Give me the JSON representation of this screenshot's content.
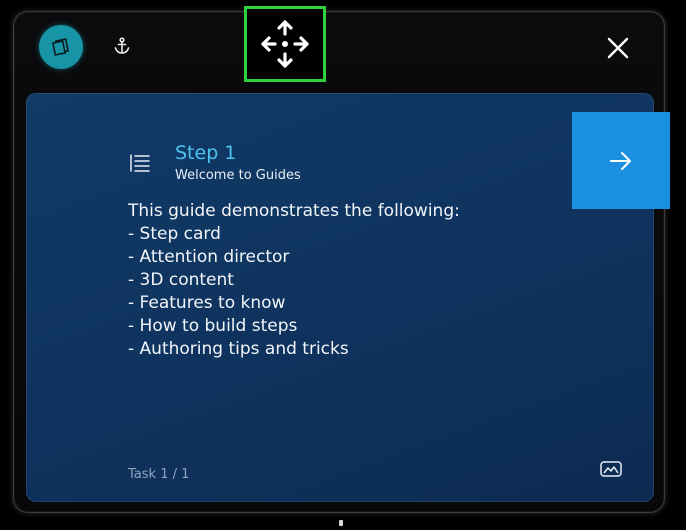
{
  "toolbar": {
    "pin_icon": "pin-window-icon",
    "anchor_icon": "anchor-icon",
    "move_icon": "move-arrows-icon",
    "close_icon": "close-icon",
    "accent_color": "#1794a6",
    "highlight_color": "#2fd23a"
  },
  "step": {
    "list_icon": "step-list-icon",
    "title": "Step 1",
    "subtitle": "Welcome to Guides",
    "body_lines": [
      "This guide demonstrates the following:",
      "- Step card",
      "- Attention director",
      "- 3D content",
      "- Features to know",
      "- How to build steps",
      "- Authoring tips and tricks"
    ],
    "title_color": "#4cc3f0"
  },
  "navigation": {
    "next_icon": "arrow-right-icon",
    "next_color": "#1b8fe0"
  },
  "footer": {
    "task_label": "Task 1 / 1",
    "gallery_icon": "media-gallery-icon"
  }
}
